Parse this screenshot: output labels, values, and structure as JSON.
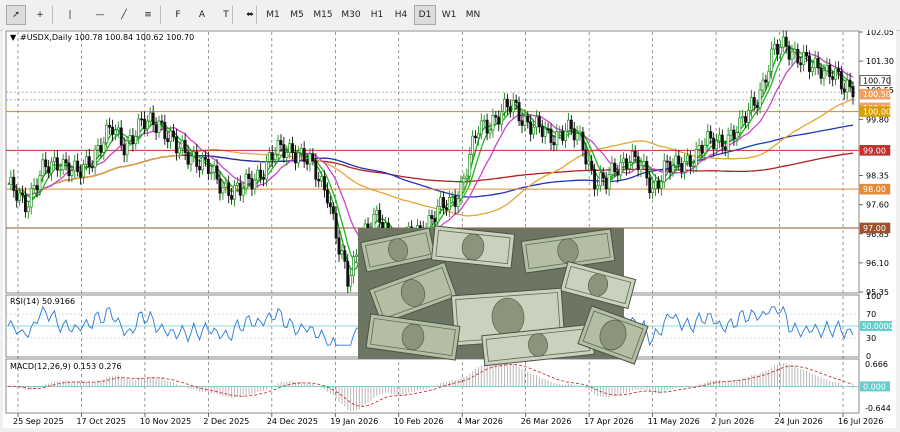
{
  "toolbar": {
    "tools": [
      "cursor-icon",
      "crosshair-icon",
      "vertical-line-icon",
      "horizontal-line-icon",
      "trendline-icon",
      "equidistant-channel-icon",
      "fibonacci-icon",
      "text-icon",
      "text-label-icon",
      "arrow-shapes-icon"
    ],
    "timeframes": [
      "M1",
      "M5",
      "M15",
      "M30",
      "H1",
      "H4",
      "D1",
      "W1",
      "MN"
    ],
    "active_timeframe": "D1"
  },
  "chart": {
    "header": "#USDX,Daily  100.78 100.84 100.62 100.70",
    "price_axis_ticks": [
      "102.05",
      "101.30",
      "100.55",
      "99.80",
      "99.05",
      "98.35",
      "97.60",
      "96.85",
      "96.10",
      "95.35"
    ],
    "level_labels": {
      "current": "100.70",
      "l1": "100.50",
      "l2": "100.30",
      "l3": "100.00",
      "l4": "99.00",
      "l5": "98.00",
      "l6": "97.00"
    },
    "rsi_title": "RSI(14) 50.9166",
    "rsi_ticks": [
      "100",
      "70",
      "50.0000",
      "30",
      "0"
    ],
    "macd_title": "MACD(12,26,9) 0.153 0.276",
    "macd_ticks": [
      "0.666",
      "0.000",
      "-0.644"
    ],
    "dates": [
      "25 Sep 2025",
      "17 Oct 2025",
      "10 Nov 2025",
      "2 Dec 2025",
      "24 Dec 2025",
      "19 Jan 2026",
      "10 Feb 2026",
      "4 Mar 2026",
      "26 Mar 2026",
      "17 Apr 2026",
      "11 May 2026",
      "2 Jun 2026",
      "24 Jun 2026",
      "16 Jul 2026"
    ]
  },
  "colors": {
    "bull": "#1f8a1f",
    "bear": "#111111",
    "ma_green": "#22b322",
    "ma_magenta": "#cc44cc",
    "ma_blue": "#2233bb",
    "ma_red": "#b02020",
    "ma_orange": "#e6a530",
    "level_gold": "#d7a000",
    "level_red": "#c03030",
    "level_orange": "#e08a3a",
    "level_brown": "#a0522d"
  },
  "chart_data": {
    "type": "candlestick",
    "symbol": "#USDX",
    "timeframe": "Daily",
    "ohlc_last": {
      "open": 100.78,
      "high": 100.84,
      "low": 100.62,
      "close": 100.7
    },
    "ylim": [
      95.35,
      102.05
    ],
    "price_path": [
      [
        0,
        98.0
      ],
      [
        6,
        97.7
      ],
      [
        12,
        98.4
      ],
      [
        18,
        98.8
      ],
      [
        24,
        98.3
      ],
      [
        30,
        99.0
      ],
      [
        36,
        99.5
      ],
      [
        40,
        99.2
      ],
      [
        46,
        99.6
      ],
      [
        52,
        99.8
      ],
      [
        58,
        99.0
      ],
      [
        64,
        98.9
      ],
      [
        72,
        98.2
      ],
      [
        80,
        97.9
      ],
      [
        86,
        98.4
      ],
      [
        92,
        98.9
      ],
      [
        98,
        99.1
      ],
      [
        104,
        98.6
      ],
      [
        110,
        98.0
      ],
      [
        114,
        96.4
      ],
      [
        117,
        95.6
      ],
      [
        122,
        96.9
      ],
      [
        128,
        97.2
      ],
      [
        134,
        96.5
      ],
      [
        140,
        96.8
      ],
      [
        146,
        97.3
      ],
      [
        152,
        97.6
      ],
      [
        156,
        98.1
      ],
      [
        162,
        99.5
      ],
      [
        168,
        99.9
      ],
      [
        174,
        100.1
      ],
      [
        180,
        99.7
      ],
      [
        186,
        99.3
      ],
      [
        192,
        99.6
      ],
      [
        198,
        99.1
      ],
      [
        202,
        98.3
      ],
      [
        206,
        98.1
      ],
      [
        210,
        98.6
      ],
      [
        214,
        98.9
      ],
      [
        218,
        98.5
      ],
      [
        222,
        98.0
      ],
      [
        226,
        98.6
      ],
      [
        230,
        98.5
      ],
      [
        236,
        98.9
      ],
      [
        240,
        99.1
      ],
      [
        246,
        99.3
      ],
      [
        252,
        99.5
      ],
      [
        256,
        100.2
      ],
      [
        260,
        100.7
      ],
      [
        264,
        101.5
      ],
      [
        268,
        101.8
      ],
      [
        272,
        101.4
      ],
      [
        276,
        101.1
      ],
      [
        280,
        101.2
      ],
      [
        284,
        101.0
      ],
      [
        288,
        100.5
      ],
      [
        291,
        100.7
      ]
    ],
    "rsi_last": 50.9166,
    "macd": {
      "main": 0.153,
      "signal": 0.276
    }
  }
}
